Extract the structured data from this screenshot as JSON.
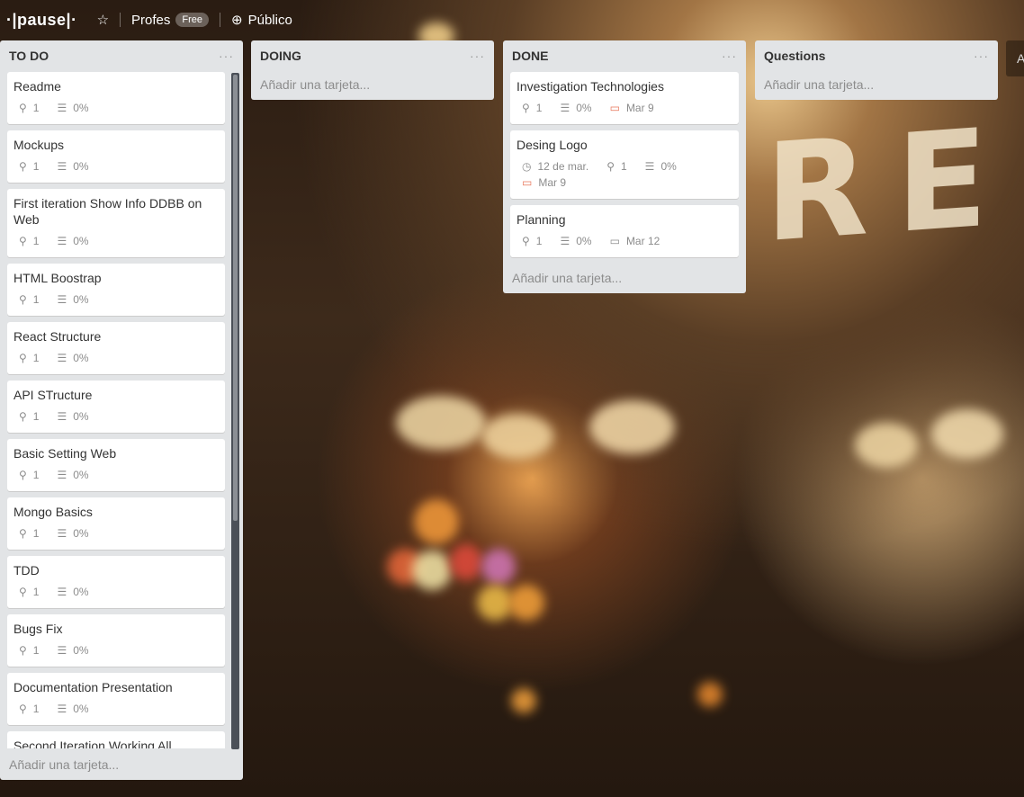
{
  "board": {
    "title": "·|pause|·",
    "team": "Profes",
    "team_badge": "Free",
    "visibility": "Público"
  },
  "edge_button": "A",
  "lists": [
    {
      "title": "TO DO",
      "add_label": "Añadir una tarjeta...",
      "cards": [
        {
          "title": "Readme",
          "attachments": "1",
          "progress": "0%"
        },
        {
          "title": "Mockups",
          "attachments": "1",
          "progress": "0%"
        },
        {
          "title": "First iteration Show Info DDBB on Web",
          "attachments": "1",
          "progress": "0%"
        },
        {
          "title": "HTML Boostrap",
          "attachments": "1",
          "progress": "0%"
        },
        {
          "title": "React Structure",
          "attachments": "1",
          "progress": "0%"
        },
        {
          "title": "API STructure",
          "attachments": "1",
          "progress": "0%"
        },
        {
          "title": "Basic Setting Web",
          "attachments": "1",
          "progress": "0%"
        },
        {
          "title": "Mongo Basics",
          "attachments": "1",
          "progress": "0%"
        },
        {
          "title": "TDD",
          "attachments": "1",
          "progress": "0%"
        },
        {
          "title": "Bugs Fix",
          "attachments": "1",
          "progress": "0%"
        },
        {
          "title": "Documentation Presentation",
          "attachments": "1",
          "progress": "0%"
        },
        {
          "title": "Second Iteration Working All Features with bugs"
        }
      ]
    },
    {
      "title": "DOING",
      "add_label": "Añadir una tarjeta..."
    },
    {
      "title": "DONE",
      "add_label": "Añadir una tarjeta...",
      "cards": [
        {
          "title": "Investigation Technologies",
          "attachments": "1",
          "progress": "0%",
          "due": "Mar 9"
        },
        {
          "title": "Desing Logo",
          "start": "12 de mar.",
          "attachments": "1",
          "progress": "0%",
          "due": "Mar 9"
        },
        {
          "title": "Planning",
          "attachments": "1",
          "progress": "0%",
          "date": "Mar 12"
        }
      ]
    },
    {
      "title": "Questions",
      "add_label": "Añadir una tarjeta..."
    }
  ],
  "icons": {
    "star": "star-icon",
    "globe": "globe-icon",
    "attachment": "paperclip-icon",
    "checklist": "checklist-icon",
    "due": "calendar-icon",
    "start": "clock-icon",
    "menu": "ellipsis-icon"
  },
  "colors": {
    "list_bg": "#e2e4e6",
    "due_icon": "#e8765b",
    "badge_text": "#8c8c8c"
  }
}
